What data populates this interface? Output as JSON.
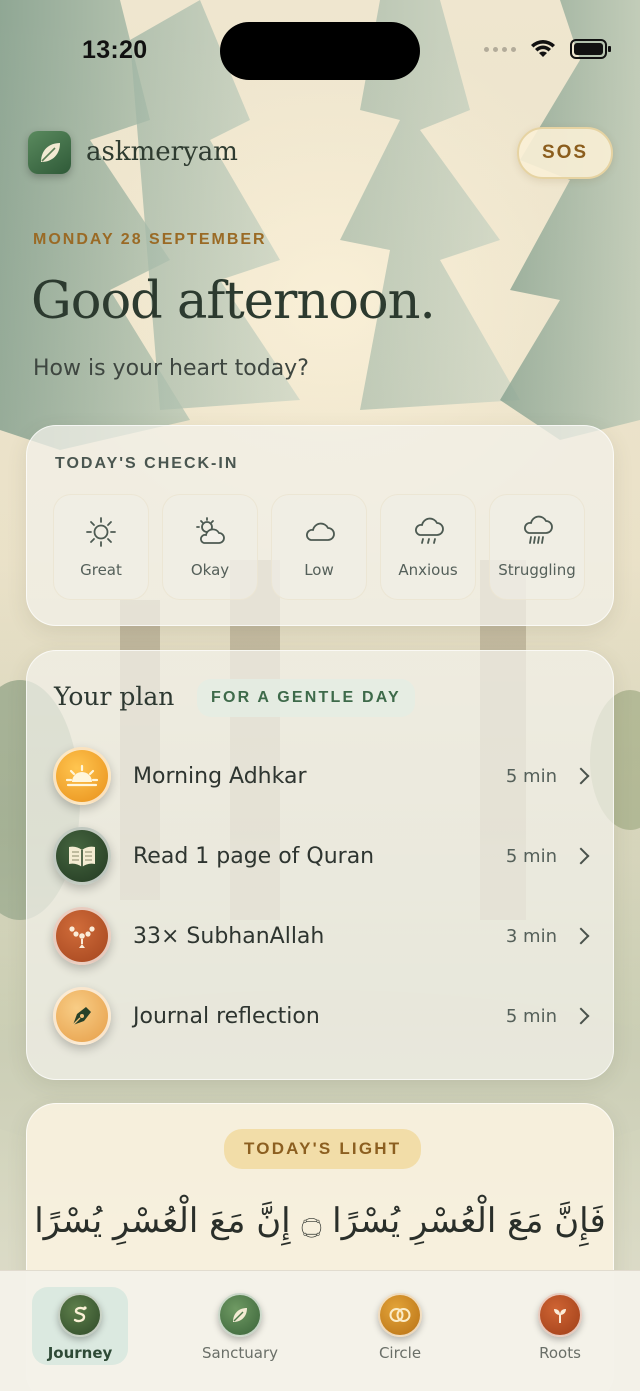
{
  "status_bar": {
    "time": "13:20"
  },
  "header": {
    "brand": "askmeryam",
    "sos_label": "SOS",
    "logo_icon": "leaf-icon"
  },
  "greeting": {
    "date": "MONDAY 28 SEPTEMBER",
    "title": "Good afternoon.",
    "subtitle": "How is your heart today?"
  },
  "checkin": {
    "title": "TODAY'S CHECK-IN",
    "moods": [
      {
        "label": "Great",
        "icon": "sun-icon"
      },
      {
        "label": "Okay",
        "icon": "partly-cloudy-icon"
      },
      {
        "label": "Low",
        "icon": "cloud-icon"
      },
      {
        "label": "Anxious",
        "icon": "rain-cloud-icon"
      },
      {
        "label": "Struggling",
        "icon": "heavy-rain-icon"
      }
    ]
  },
  "plan": {
    "title": "Your plan",
    "badge": "FOR A GENTLE DAY",
    "items": [
      {
        "label": "Morning Adhkar",
        "time": "5 min",
        "icon": "sunrise-icon",
        "color": "#f0a02a"
      },
      {
        "label": "Read 1 page of Quran",
        "time": "5 min",
        "icon": "open-book-icon",
        "color": "#2f4a2e"
      },
      {
        "label": "33× SubhanAllah",
        "time": "3 min",
        "icon": "prayer-beads-icon",
        "color": "#b9562a"
      },
      {
        "label": "Journal reflection",
        "time": "5 min",
        "icon": "pen-nib-icon",
        "color": "#f1b969"
      }
    ]
  },
  "light": {
    "badge": "TODAY'S LIGHT",
    "verse": "فَإِنَّ مَعَ الْعُسْرِ يُسْرًا ۝ إِنَّ مَعَ الْعُسْرِ يُسْرًا"
  },
  "tabs": [
    {
      "label": "Journey",
      "icon": "journey-icon",
      "active": true
    },
    {
      "label": "Sanctuary",
      "icon": "leaf-icon",
      "active": false
    },
    {
      "label": "Circle",
      "icon": "rings-icon",
      "active": false
    },
    {
      "label": "Roots",
      "icon": "sprout-icon",
      "active": false
    }
  ]
}
